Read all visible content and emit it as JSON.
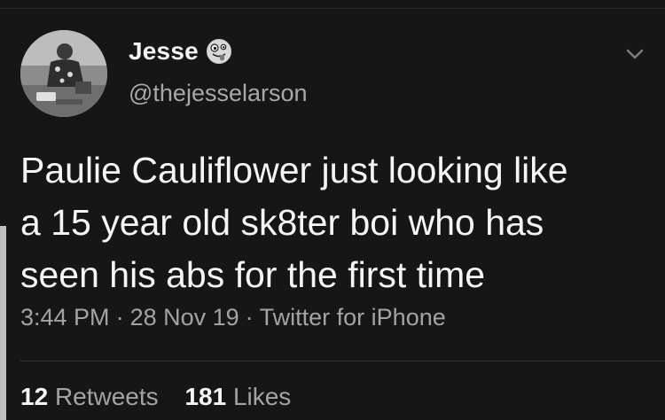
{
  "colors": {
    "background": "#161616",
    "text_primary": "#f5f5f5",
    "text_secondary": "#a3a3a3"
  },
  "author": {
    "display_name": "Jesse",
    "emoji_icon": "zany-face-icon",
    "handle": "@thejesselarson",
    "avatar_icon": "avatar-photo"
  },
  "menu": {
    "icon": "chevron-down-icon"
  },
  "tweet": {
    "text_lines": [
      "Paulie Cauliflower just looking like",
      "a 15 year old sk8ter boi who has",
      "seen his abs for the first time"
    ]
  },
  "meta": {
    "time": "3:44 PM",
    "separator": "·",
    "date": "28 Nov 19",
    "source": "Twitter for iPhone"
  },
  "stats": {
    "retweets_count": "12",
    "retweets_label": "Retweets",
    "likes_count": "181",
    "likes_label": "Likes"
  }
}
